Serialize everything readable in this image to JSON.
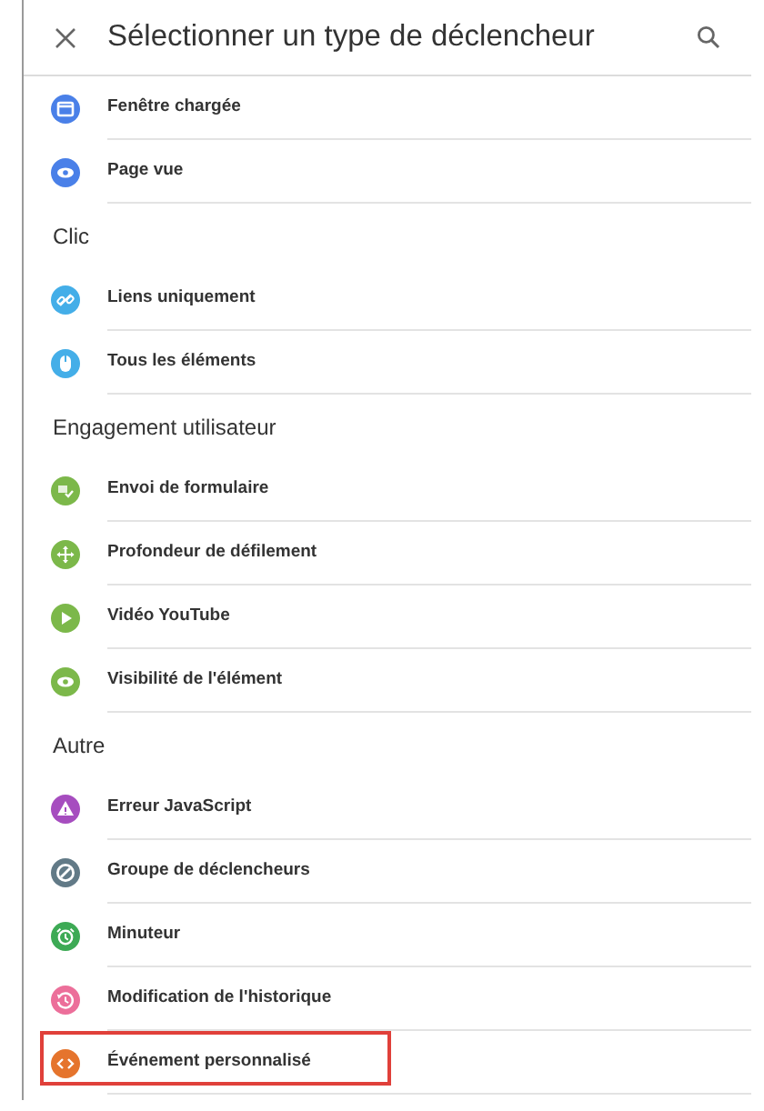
{
  "header": {
    "title": "Sélectionner un type de déclencheur"
  },
  "sections": [
    {
      "items": [
        {
          "label": "Fenêtre chargée",
          "color": "#4a80e8",
          "highlighted": false
        },
        {
          "label": "Page vue",
          "color": "#4a80e8",
          "highlighted": false
        }
      ]
    },
    {
      "title": "Clic",
      "items": [
        {
          "label": "Liens uniquement",
          "color": "#44aee8",
          "highlighted": false
        },
        {
          "label": "Tous les éléments",
          "color": "#44aee8",
          "highlighted": false
        }
      ]
    },
    {
      "title": "Engagement utilisateur",
      "items": [
        {
          "label": "Envoi de formulaire",
          "color": "#7cb84a",
          "highlighted": false
        },
        {
          "label": "Profondeur de défilement",
          "color": "#7cb84a",
          "highlighted": false
        },
        {
          "label": "Vidéo YouTube",
          "color": "#7cb84a",
          "highlighted": false
        },
        {
          "label": "Visibilité de l'élément",
          "color": "#7cb84a",
          "highlighted": false
        }
      ]
    },
    {
      "title": "Autre",
      "items": [
        {
          "label": "Erreur JavaScript",
          "color": "#a64dbf",
          "highlighted": false
        },
        {
          "label": "Groupe de déclencheurs",
          "color": "#627a87",
          "highlighted": false
        },
        {
          "label": "Minuteur",
          "color": "#3daa55",
          "highlighted": false
        },
        {
          "label": "Modification de l'historique",
          "color": "#ec6f9a",
          "highlighted": false
        },
        {
          "label": "Événement personnalisé",
          "color": "#e5742d",
          "highlighted": true
        }
      ]
    }
  ]
}
